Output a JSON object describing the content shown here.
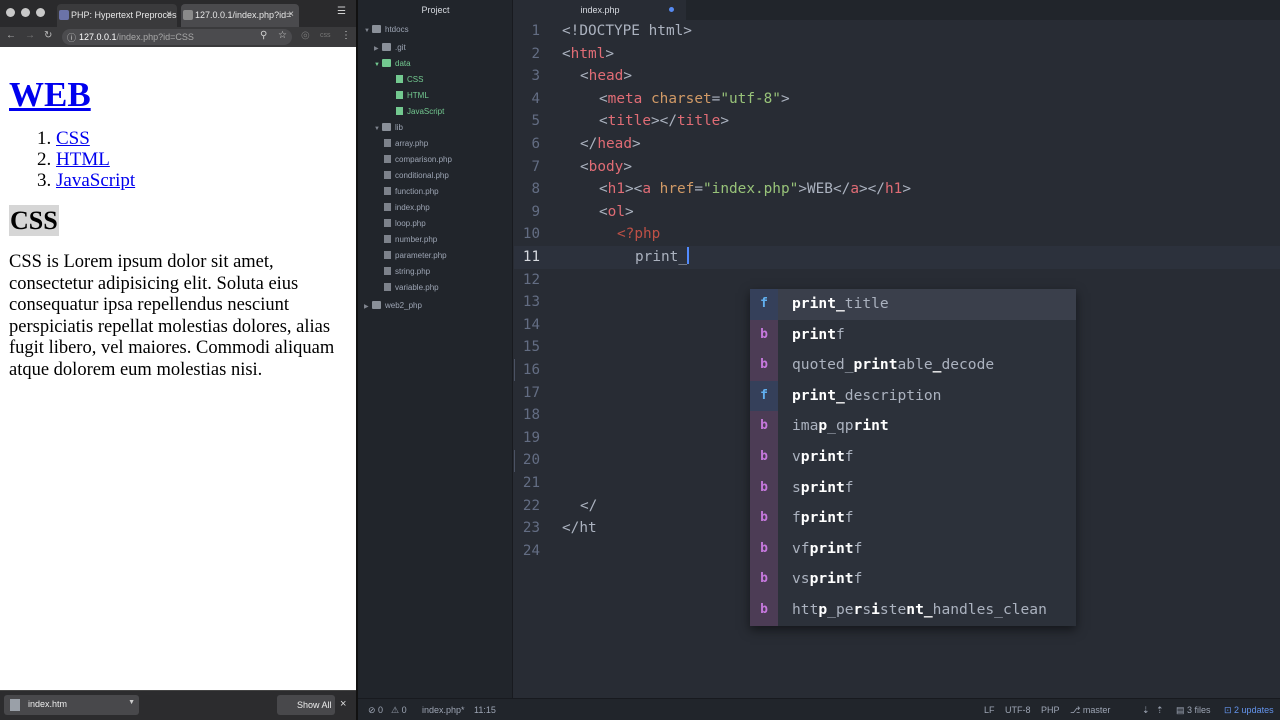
{
  "browser": {
    "tabs": [
      {
        "title": "PHP: Hypertext Preprocess"
      },
      {
        "title": "127.0.0.1/index.php?id="
      }
    ],
    "url": {
      "host": "127.0.0.1",
      "path": "/index.php?id=CSS"
    },
    "page": {
      "heading": "WEB",
      "list": [
        "CSS",
        "HTML",
        "JavaScript"
      ],
      "subheading": "CSS",
      "paragraph": "CSS is Lorem ipsum dolor sit amet, consectetur adipisicing elit. Soluta eius consequatur ipsa repellendus nesciunt perspiciatis repellat molestias dolores, alias fugit libero, vel maiores. Commodi aliquam atque dolorem eum molestias nisi."
    },
    "downloads": {
      "file": "index.htm",
      "show_all": "Show All"
    }
  },
  "editor": {
    "tree_title": "Project",
    "tree": {
      "root": "htdocs",
      "git": ".git",
      "data": "data",
      "data_files": [
        "CSS",
        "HTML",
        "JavaScript"
      ],
      "lib": "lib",
      "lib_files": [
        "array.php",
        "comparison.php",
        "conditional.php",
        "function.php",
        "index.php",
        "loop.php",
        "number.php",
        "parameter.php",
        "string.php",
        "variable.php"
      ],
      "web2": "web2_php"
    },
    "tab_title": "index.php",
    "line_numbers": [
      "1",
      "2",
      "3",
      "4",
      "5",
      "6",
      "7",
      "8",
      "9",
      "10",
      "11",
      "12",
      "13",
      "14",
      "15",
      "16",
      "17",
      "18",
      "19",
      "20",
      "21",
      "22",
      "23",
      "24"
    ],
    "code": {
      "l1": "<!DOCTYPE html>",
      "l2_tag": "html",
      "l3_tag": "head",
      "l4_tag": "meta",
      "l4_attr": "charset",
      "l4_val": "\"utf-8\"",
      "l5_tag": "title",
      "l6_tag": "head",
      "l7_tag": "body",
      "l8_h1": "h1",
      "l8_a": "a",
      "l8_attr": "href",
      "l8_val": "\"index.php\"",
      "l8_text": "WEB",
      "l9_tag": "ol",
      "l10": "<?php",
      "l11": "print_",
      "l22": "</",
      "l23": "</ht"
    },
    "autocomplete": [
      {
        "badge": "f",
        "pre": "",
        "parts": [
          [
            "prin",
            "b"
          ],
          [
            "t_",
            ""
          ],
          [
            "t",
            "b"
          ],
          [
            "itle",
            ""
          ]
        ],
        "text": "print_title"
      },
      {
        "badge": "b",
        "text": "printf"
      },
      {
        "badge": "b",
        "text": "quoted_printable_decode"
      },
      {
        "badge": "f",
        "text": "print_description"
      },
      {
        "badge": "b",
        "text": "imap_qprint"
      },
      {
        "badge": "b",
        "text": "vprintf"
      },
      {
        "badge": "b",
        "text": "sprintf"
      },
      {
        "badge": "b",
        "text": "fprintf"
      },
      {
        "badge": "b",
        "text": "vfprintf"
      },
      {
        "badge": "b",
        "text": "vsprintf"
      },
      {
        "badge": "b",
        "text": "http_persistent_handles_clean"
      }
    ],
    "status": {
      "errors": "0",
      "warnings": "0",
      "file": "index.php*",
      "cursor": "11:15",
      "eol": "LF",
      "encoding": "UTF-8",
      "grammar": "PHP",
      "branch": "master",
      "files": "3 files",
      "updates": "2 updates"
    }
  }
}
